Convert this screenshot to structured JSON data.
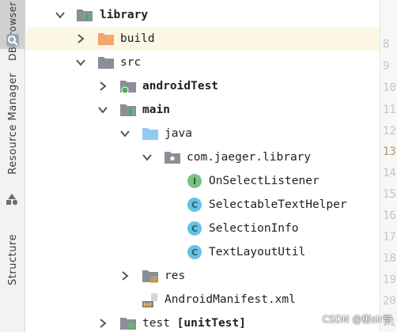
{
  "sidebar": {
    "tabs": [
      {
        "label": "DB Browser",
        "icon": "db-browser-icon"
      },
      {
        "label": "Resource Manager",
        "icon": "resource-manager-icon"
      },
      {
        "label": "Structure",
        "icon": "structure-icon"
      }
    ]
  },
  "tree": {
    "library": "library",
    "build": "build",
    "src": "src",
    "androidTest": "androidTest",
    "main": "main",
    "java": "java",
    "package": "com.jaeger.library",
    "classes": [
      {
        "name": "OnSelectListener",
        "kind": "interface",
        "badge": "I",
        "color": "#7cc27f"
      },
      {
        "name": "SelectableTextHelper",
        "kind": "class",
        "badge": "C",
        "color": "#66c2e0"
      },
      {
        "name": "SelectionInfo",
        "kind": "class",
        "badge": "C",
        "color": "#66c2e0"
      },
      {
        "name": "TextLayoutUtil",
        "kind": "class",
        "badge": "C",
        "color": "#66c2e0"
      }
    ],
    "res": "res",
    "manifest": "AndroidManifest.xml",
    "manifest_badge": "MF",
    "test": "test",
    "test_suffix": "[unitTest]"
  },
  "gutter": {
    "line_numbers": [
      "8",
      "9",
      "10",
      "11",
      "12",
      "13",
      "14",
      "15",
      "16",
      "17",
      "18",
      "19",
      "20",
      "21"
    ]
  },
  "watermark": "CSDN @彬sir哥",
  "colors": {
    "highlight": "#fcf7e4",
    "folder": "#90caf0",
    "excluded_folder": "#f6a56c",
    "module_folder": "#8a8f97",
    "interface_badge": "#7cc27f",
    "class_badge": "#66c2e0"
  }
}
